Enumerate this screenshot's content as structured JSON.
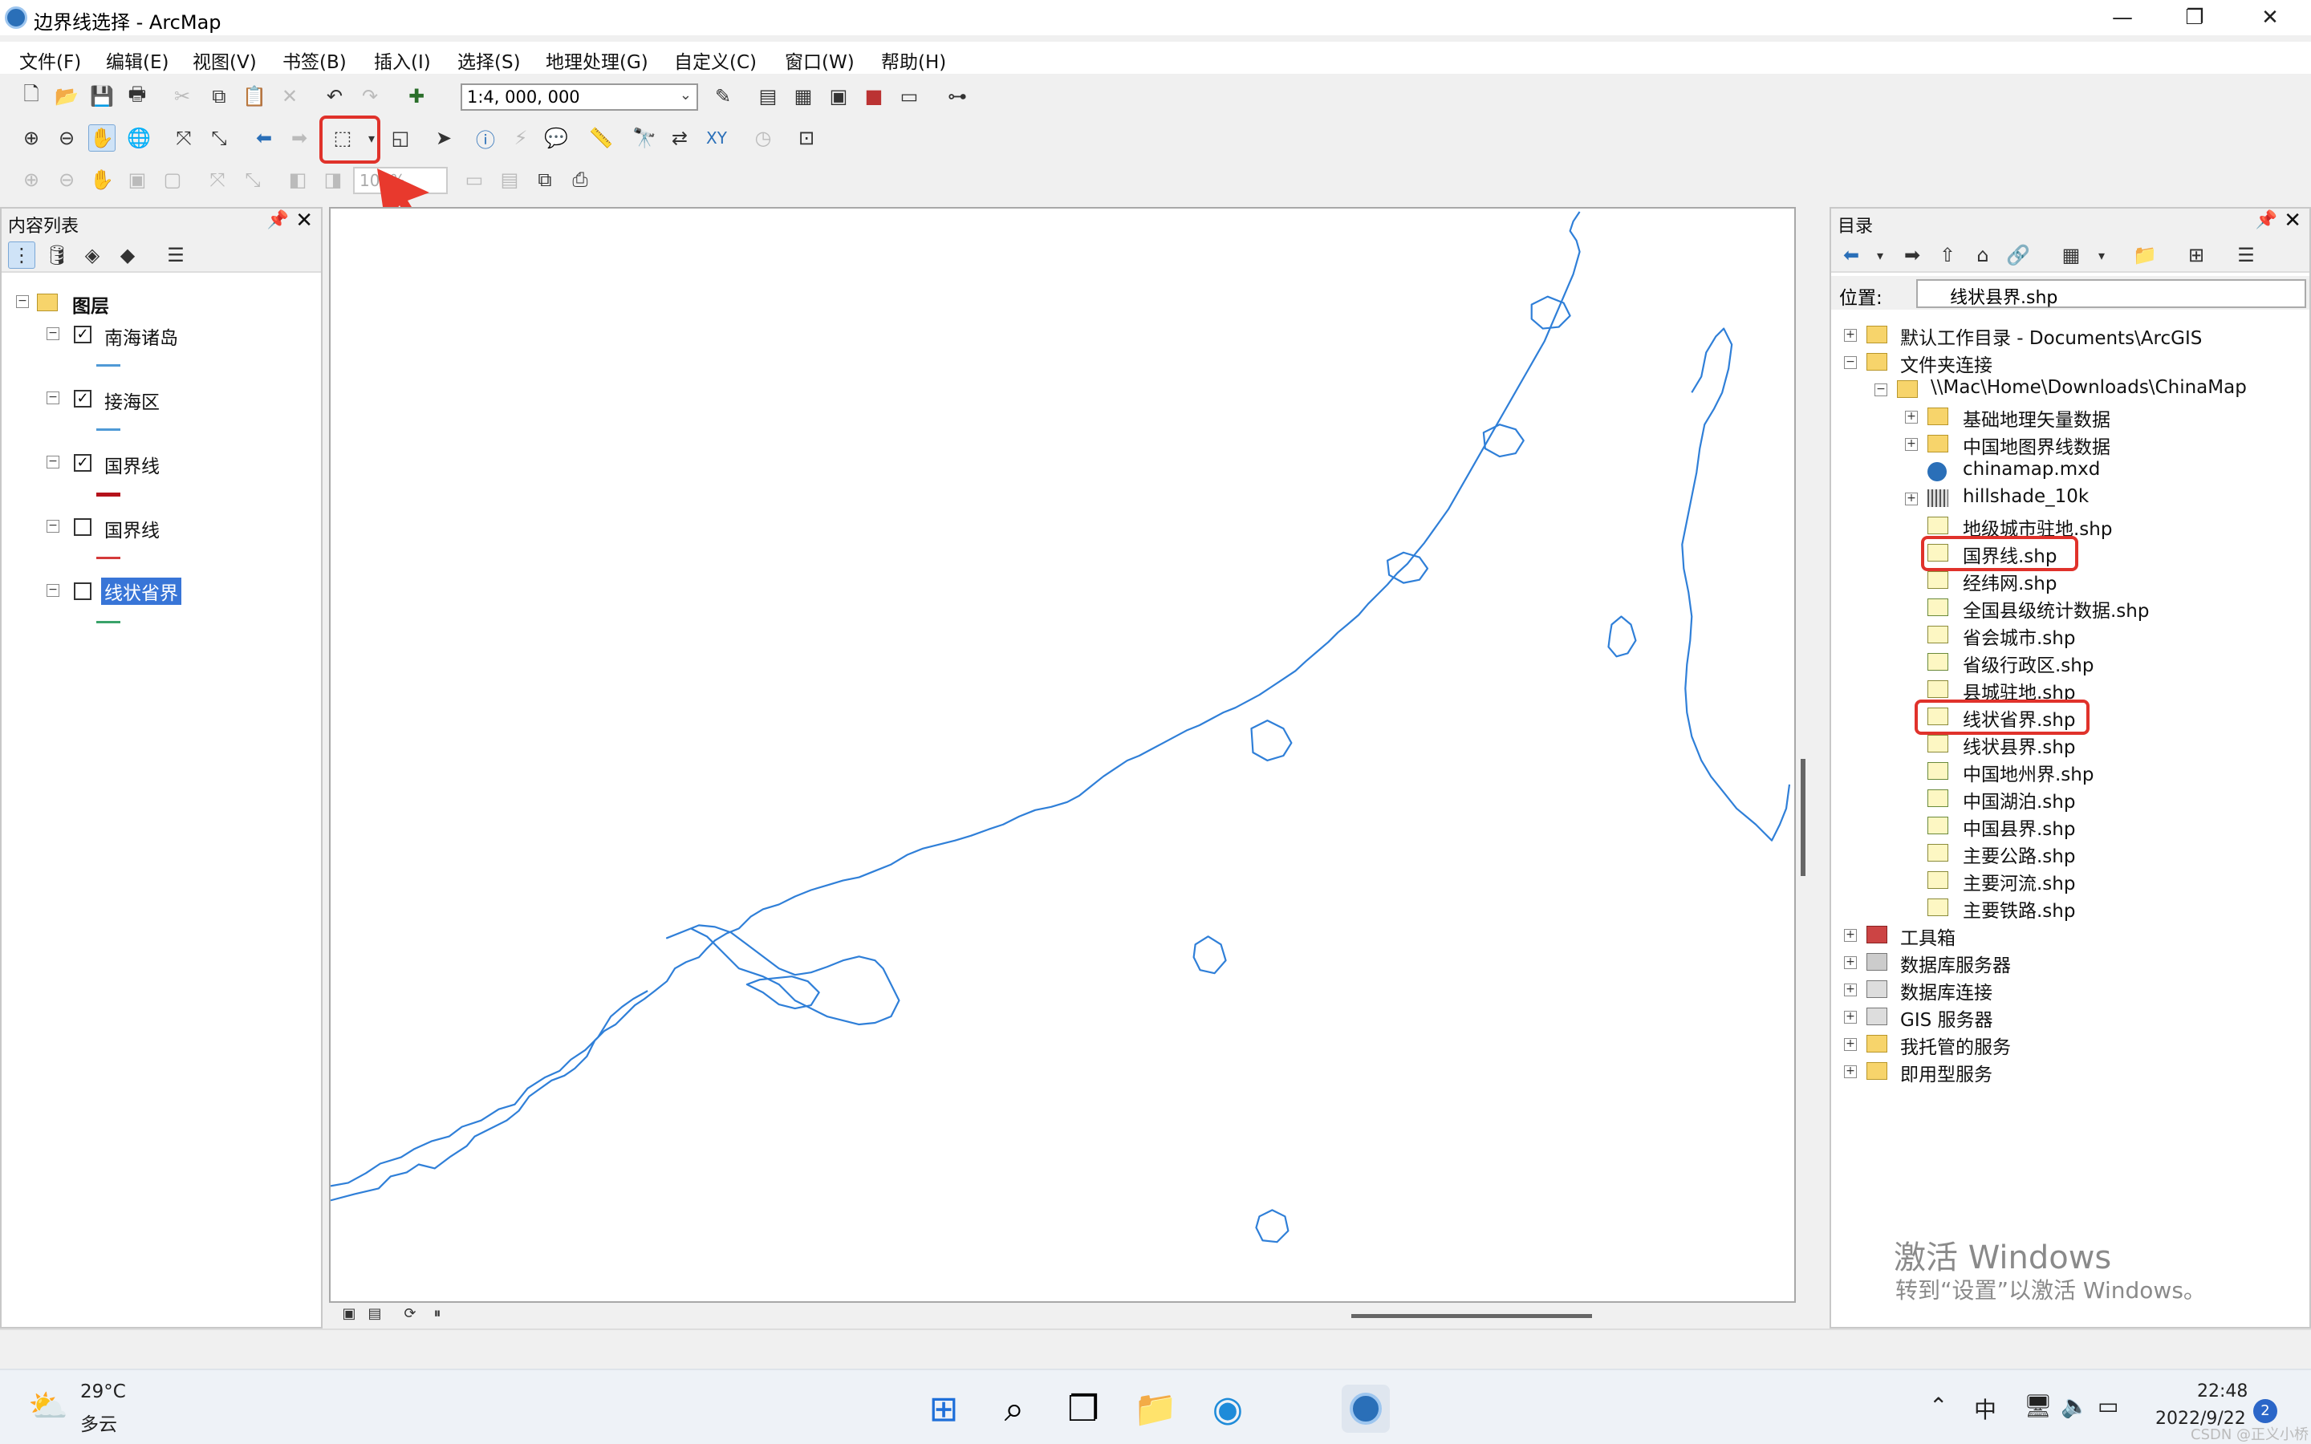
{
  "window": {
    "title": "边界线选择 - ArcMap",
    "minimize": "—",
    "restore": "❐",
    "close": "✕"
  },
  "menu": [
    "文件(F)",
    "编辑(E)",
    "视图(V)",
    "书签(B)",
    "插入(I)",
    "选择(S)",
    "地理处理(G)",
    "自定义(C)",
    "窗口(W)",
    "帮助(H)"
  ],
  "toolbar": {
    "scale_value": "1:4, 000, 000",
    "zoom_value": "100%"
  },
  "toc": {
    "title": "内容列表",
    "root_label": "图层",
    "layers": [
      {
        "name": "南海诸岛",
        "checked": true,
        "color": "#4f9ad6"
      },
      {
        "name": "接海区",
        "checked": true,
        "color": "#4f9ad6"
      },
      {
        "name": "国界线",
        "checked": true,
        "color": "#b5121b"
      },
      {
        "name": "国界线",
        "checked": false,
        "color": "#d43a3a"
      },
      {
        "name": "线状省界",
        "checked": false,
        "color": "#3aa36a",
        "selected": true
      }
    ]
  },
  "catalog": {
    "title": "目录",
    "location_label": "位置:",
    "location_value": "线状县界.shp",
    "tree": {
      "default_home": "默认工作目录 - Documents\\ArcGIS",
      "folder_connections": "文件夹连接",
      "connection_path": "\\\\Mac\\Home\\Downloads\\ChinaMap",
      "items": [
        "基础地理矢量数据",
        "中国地图界线数据",
        "chinamap.mxd",
        "hillshade_10k",
        "地级城市驻地.shp",
        "国界线.shp",
        "经纬网.shp",
        "全国县级统计数据.shp",
        "省会城市.shp",
        "省级行政区.shp",
        "县城驻地.shp",
        "线状省界.shp",
        "线状县界.shp",
        "中国地州界.shp",
        "中国湖泊.shp",
        "中国县界.shp",
        "主要公路.shp",
        "主要河流.shp",
        "主要铁路.shp"
      ],
      "bottom_nodes": [
        "工具箱",
        "数据库服务器",
        "数据库连接",
        "GIS 服务器",
        "我托管的服务",
        "即用型服务"
      ]
    }
  },
  "watermark": {
    "line1": "激活 Windows",
    "line2": "转到“设置”以激活 Windows。"
  },
  "taskbar": {
    "weather_temp": "29°C",
    "weather_desc": "多云",
    "time": "22:48",
    "date": "2022/9/22",
    "notifications": "2",
    "ime": "中"
  },
  "footer_watermark": "CSDN @正义小桥",
  "colors": {
    "accent_red": "#e0322b",
    "map_line": "#2f7fd8",
    "selection": "#3875d7"
  }
}
